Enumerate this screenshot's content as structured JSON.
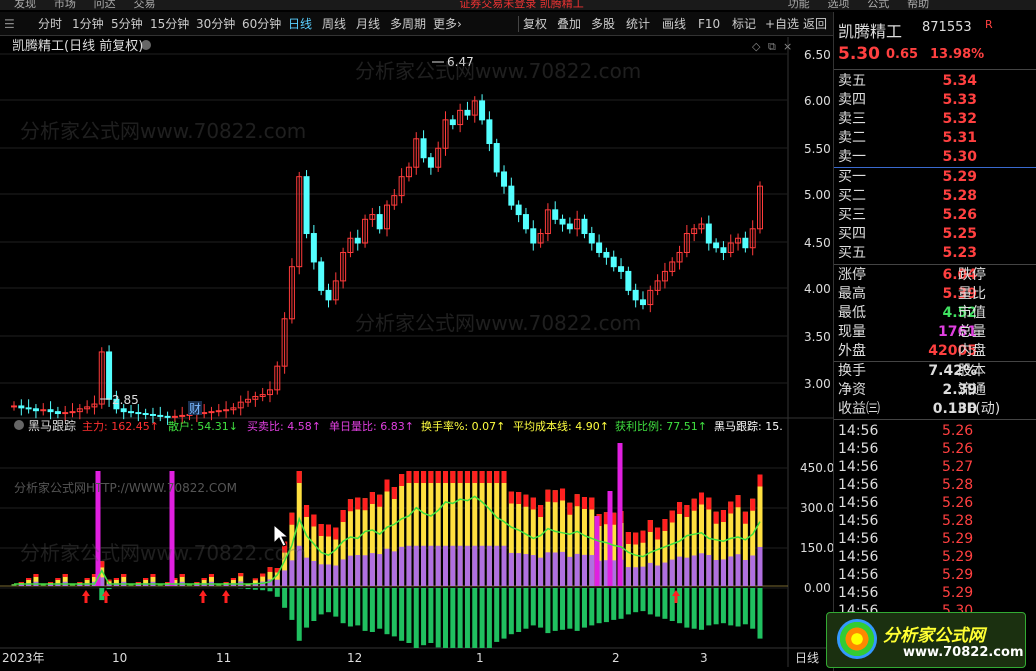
{
  "menu": [
    "发现",
    "市场",
    "问达",
    "交易"
  ],
  "menu_notice": "证券交易未登录 凯腾精工",
  "menu_right": [
    "功能",
    "选项",
    "公式",
    "帮助"
  ],
  "toolbar": {
    "periods": [
      "分时",
      "1分钟",
      "5分钟",
      "15分钟",
      "30分钟",
      "60分钟",
      "日线",
      "周线",
      "月线",
      "多周期",
      "更多›"
    ],
    "active": "日线",
    "tools": [
      "复权",
      "叠加",
      "多股",
      "统计",
      "画线",
      "F10",
      "标记",
      "+自选",
      "返回"
    ]
  },
  "chart_header": {
    "title": "凯腾精工(日线 前复权)"
  },
  "main_chart": {
    "price_ticks": [
      "6.50",
      "6.00",
      "5.50",
      "5.00",
      "4.50",
      "4.00",
      "3.50",
      "3.00"
    ],
    "high_label": "6.47",
    "low_label": "2.85",
    "fin_label": "财"
  },
  "indicator_header": {
    "name": "黑马跟踪",
    "items": [
      {
        "label": "主力:",
        "value": "162.45",
        "arrow": "↑",
        "color": "#ff3030"
      },
      {
        "label": "散户:",
        "value": "54.31",
        "arrow": "↓",
        "color": "#40e040"
      },
      {
        "label": "买卖比:",
        "value": "4.58",
        "arrow": "↑",
        "color": "#e040e0"
      },
      {
        "label": "单日量比:",
        "value": "6.83",
        "arrow": "↑",
        "color": "#e040e0"
      },
      {
        "label": "换手率%:",
        "value": "0.07",
        "arrow": "↑",
        "color": "#ffff40"
      },
      {
        "label": "平均成本线:",
        "value": "4.90",
        "arrow": "↑",
        "color": "#ffff40"
      },
      {
        "label": "获利比例:",
        "value": "77.51",
        "arrow": "↑",
        "color": "#40e040"
      },
      {
        "label": "黑马跟踪:",
        "value": "15.",
        "arrow": "",
        "color": "#ffffff"
      }
    ],
    "watermark": "分析家公式网HTTP://WWW.70822.COM"
  },
  "indicator_ticks": [
    "450.0",
    "300.0",
    "150.0",
    "0.00"
  ],
  "x_axis": {
    "labels": [
      "2023年",
      "10",
      "11",
      "12",
      "1",
      "2",
      "3"
    ],
    "period": "日线"
  },
  "watermarks": [
    "分析家公式网www.70822.com"
  ],
  "stock": {
    "name": "凯腾精工",
    "code": "871553",
    "r_mark": "R",
    "price": "5.30",
    "change": "0.65",
    "change_pct": "13.98%"
  },
  "orderbook": {
    "sell": [
      {
        "label": "卖五",
        "price": "5.34"
      },
      {
        "label": "卖四",
        "price": "5.33"
      },
      {
        "label": "卖三",
        "price": "5.32"
      },
      {
        "label": "卖二",
        "price": "5.31"
      },
      {
        "label": "卖一",
        "price": "5.30"
      }
    ],
    "buy": [
      {
        "label": "买一",
        "price": "5.29"
      },
      {
        "label": "买二",
        "price": "5.28"
      },
      {
        "label": "买三",
        "price": "5.26"
      },
      {
        "label": "买四",
        "price": "5.25"
      },
      {
        "label": "买五",
        "price": "5.23"
      }
    ]
  },
  "stats": [
    {
      "l1": "涨停",
      "v": "6.04",
      "c": "red",
      "l2": "跌停"
    },
    {
      "l1": "最高",
      "v": "5.39",
      "c": "red",
      "l2": "量比"
    },
    {
      "l1": "最低",
      "v": "4.52",
      "c": "green",
      "l2": "市值"
    },
    {
      "l1": "现量",
      "v": "1761",
      "c": "mag",
      "l2": "总量"
    },
    {
      "l1": "外盘",
      "v": "42005",
      "c": "red",
      "l2": "内盘"
    }
  ],
  "stats2": [
    {
      "l1": "换手",
      "v": "7.42%",
      "c": "white",
      "l2": "股本"
    },
    {
      "l1": "净资",
      "v": "2.39",
      "c": "white",
      "l2": "流通"
    },
    {
      "l1": "收益㈢",
      "v": "0.130",
      "c": "white",
      "l2": "PE(动)"
    }
  ],
  "ticks": [
    {
      "time": "14:56",
      "price": "5.26"
    },
    {
      "time": "14:56",
      "price": "5.26"
    },
    {
      "time": "14:56",
      "price": "5.27"
    },
    {
      "time": "14:56",
      "price": "5.28"
    },
    {
      "time": "14:56",
      "price": "5.26"
    },
    {
      "time": "14:56",
      "price": "5.28"
    },
    {
      "time": "14:56",
      "price": "5.29"
    },
    {
      "time": "14:56",
      "price": "5.29"
    },
    {
      "time": "14:56",
      "price": "5.29"
    },
    {
      "time": "14:56",
      "price": "5.29"
    },
    {
      "time": "14:56",
      "price": "5.30"
    }
  ],
  "logo": {
    "name": "分析家公式网",
    "url": "www.70822.com"
  },
  "chart_data": {
    "type": "candlestick",
    "y_range": [
      2.8,
      6.6
    ],
    "closes": [
      2.98,
      2.96,
      2.95,
      2.93,
      2.94,
      2.92,
      2.9,
      2.91,
      2.92,
      2.95,
      2.97,
      3.0,
      3.55,
      3.05,
      2.95,
      2.92,
      2.91,
      2.9,
      2.89,
      2.88,
      2.87,
      2.86,
      2.87,
      2.88,
      2.89,
      2.9,
      2.91,
      2.92,
      2.93,
      2.94,
      2.96,
      3.02,
      3.05,
      3.08,
      3.1,
      3.15,
      3.4,
      3.9,
      4.45,
      5.4,
      4.8,
      4.5,
      4.2,
      4.1,
      4.3,
      4.6,
      4.75,
      4.7,
      4.95,
      5.0,
      4.85,
      5.1,
      5.2,
      5.4,
      5.5,
      5.8,
      5.6,
      5.5,
      5.7,
      6.0,
      5.95,
      6.1,
      6.05,
      6.2,
      6.0,
      5.75,
      5.45,
      5.3,
      5.1,
      5.0,
      4.85,
      4.7,
      4.8,
      5.05,
      4.95,
      4.9,
      4.85,
      4.95,
      4.8,
      4.7,
      4.6,
      4.55,
      4.45,
      4.4,
      4.2,
      4.1,
      4.05,
      4.2,
      4.3,
      4.4,
      4.5,
      4.6,
      4.8,
      4.85,
      4.9,
      4.7,
      4.65,
      4.6,
      4.7,
      4.75,
      4.65,
      4.85,
      5.3
    ]
  }
}
